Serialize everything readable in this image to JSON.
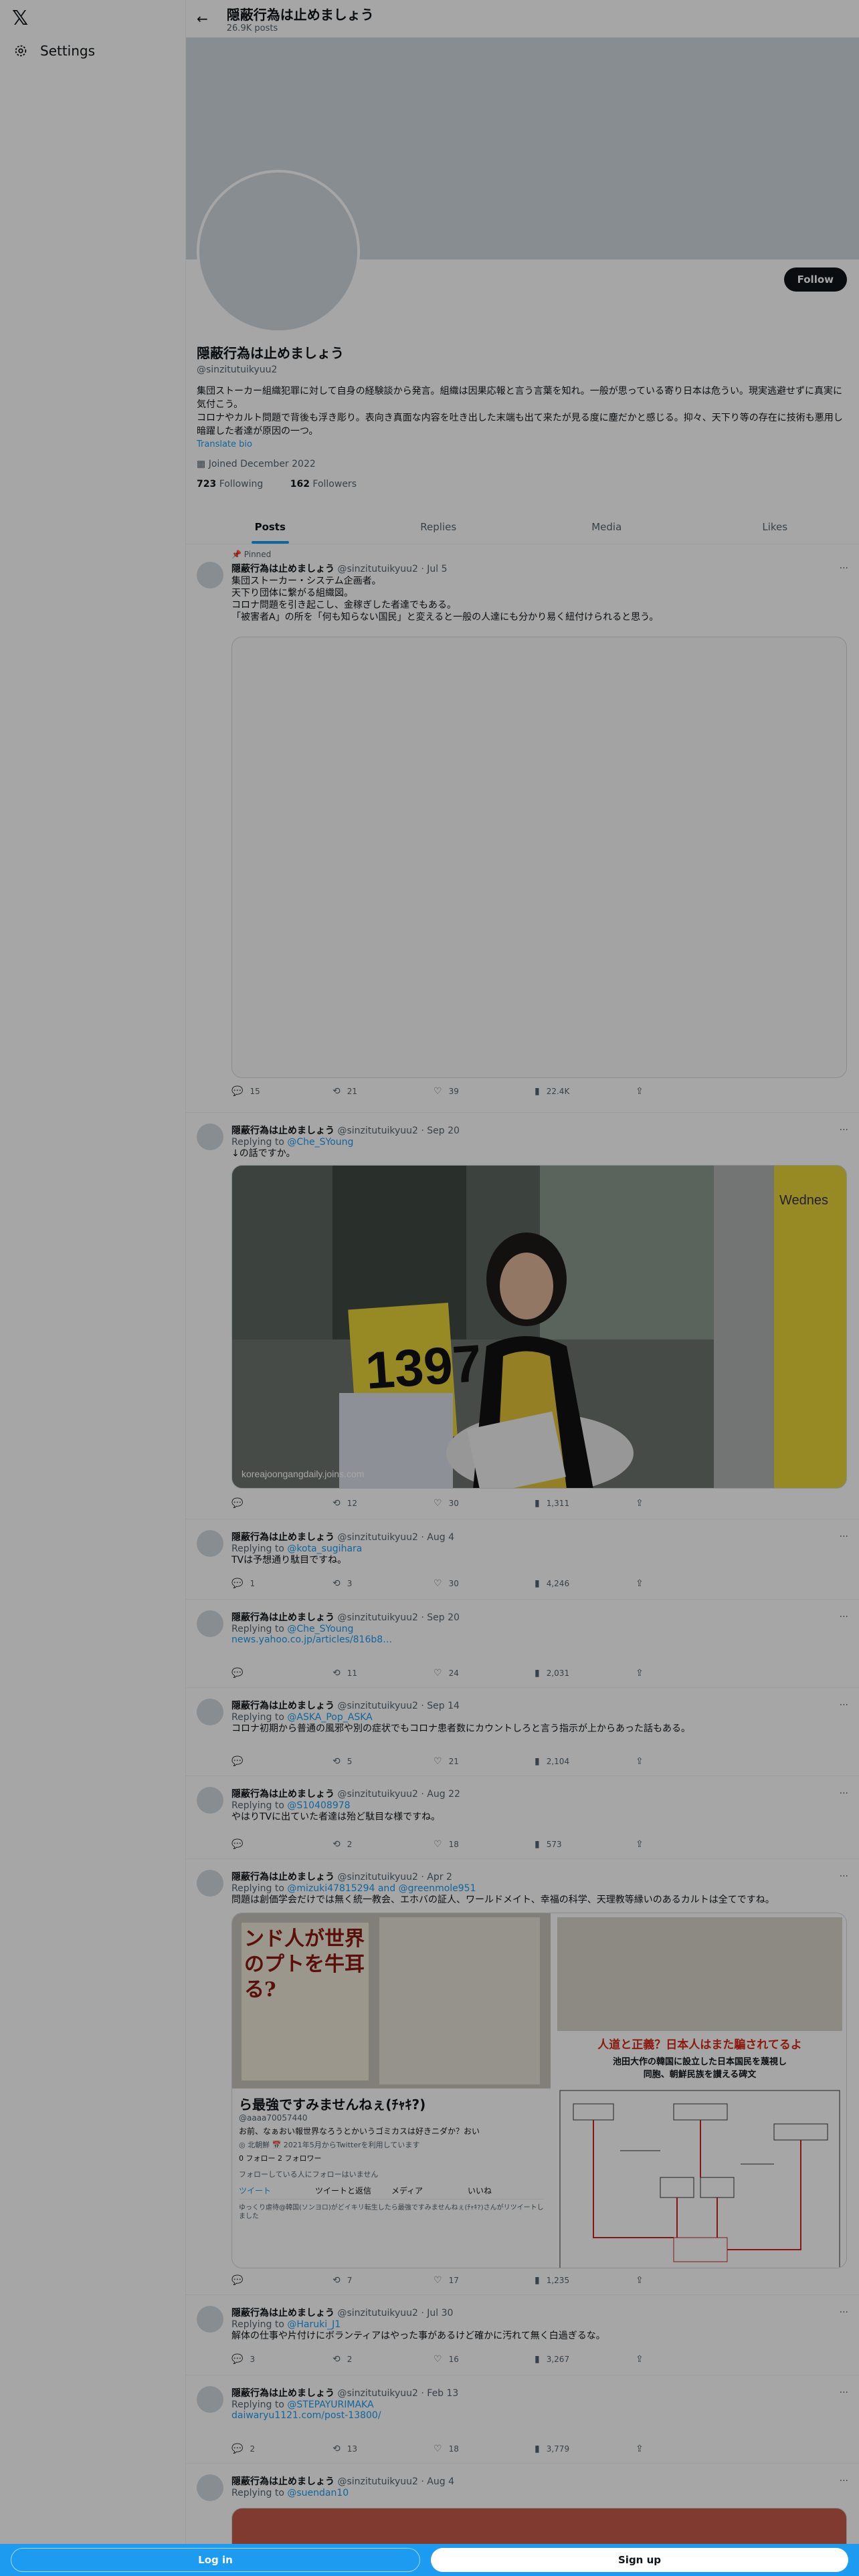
{
  "sidebar": {
    "logo": "𝕏",
    "settings_label": "Settings"
  },
  "topbar": {
    "name": "隠蔽行為は止めましょう",
    "posts": "26.9K posts"
  },
  "profile": {
    "follow_label": "Follow",
    "name": "隠蔽行為は止めましょう",
    "handle": "@sinzitutuikyuu2",
    "bio": "集団ストーカー組織犯罪に対して自身の経験談から発言。組織は因果応報と言う言葉を知れ。一般が思っている寄り日本は危うい。現実逃避せずに真実に気付こう。\nコロナやカルト問題で背後も浮き彫り。表向き真面な内容を吐き出した末端も出て来たが見る度に塵だかと感じる。抑々、天下り等の存在に技術も悪用し暗躍した者達が原因の一つ。",
    "translate": "Translate bio",
    "joined": "Joined December 2022",
    "following_count": "723",
    "following_label": "Following",
    "followers_count": "162",
    "followers_label": "Followers"
  },
  "tabs": [
    "Posts",
    "Replies",
    "Media",
    "Likes"
  ],
  "tweets": [
    {
      "pinned": "Pinned",
      "name": "隠蔽行為は止めましょう",
      "handle": "@sinzitutuikyuu2",
      "date": "· Jul 5",
      "reply_label": "",
      "reply_to": "",
      "text": "集団ストーカー・システム企画者。\n天下り団体に繋がる組織図。\nコロナ問題を引き起こし、金稼ぎした者達でもある。\n「被害者A」の所を「何も知らない国民」と変えると一般の人達にも分かり易く紐付けられると思う。",
      "link": "",
      "replies": "15",
      "retweets": "21",
      "likes": "39",
      "views": "22.4K"
    },
    {
      "pinned": "",
      "name": "隠蔽行為は止めましょう",
      "handle": "@sinzitutuikyuu2",
      "date": "· Sep 20",
      "reply_label": "Replying to",
      "reply_to": "@Che_SYoung",
      "text": "↓の話ですか。",
      "link": "",
      "replies": "",
      "retweets": "12",
      "likes": "30",
      "views": "1,311",
      "photo_sign": "1397",
      "photo_banner": "Wednes",
      "photo_caption": "koreajoongangdaily.joins.com"
    },
    {
      "pinned": "",
      "name": "隠蔽行為は止めましょう",
      "handle": "@sinzitutuikyuu2",
      "date": "· Aug 4",
      "reply_label": "Replying to",
      "reply_to": "@kota_sugihara",
      "text": "TVは予想通り駄目ですね。",
      "link": "",
      "replies": "1",
      "retweets": "3",
      "likes": "30",
      "views": "4,246"
    },
    {
      "pinned": "",
      "name": "隠蔽行為は止めましょう",
      "handle": "@sinzitutuikyuu2",
      "date": "· Sep 20",
      "reply_label": "Replying to",
      "reply_to": "@Che_SYoung",
      "text": "",
      "link": "news.yahoo.co.jp/articles/816b8…",
      "replies": "",
      "retweets": "11",
      "likes": "24",
      "views": "2,031"
    },
    {
      "pinned": "",
      "name": "隠蔽行為は止めましょう",
      "handle": "@sinzitutuikyuu2",
      "date": "· Sep 14",
      "reply_label": "Replying to",
      "reply_to": "@ASKA_Pop_ASKA",
      "text": "コロナ初期から普通の風邪や別の症状でもコロナ患者数にカウントしろと言う指示が上からあった話もある。",
      "link": "",
      "replies": "",
      "retweets": "5",
      "likes": "21",
      "views": "2,104"
    },
    {
      "pinned": "",
      "name": "隠蔽行為は止めましょう",
      "handle": "@sinzitutuikyuu2",
      "date": "· Aug 22",
      "reply_label": "Replying to",
      "reply_to": "@S10408978",
      "text": "やはりTVに出ていた者達は殆ど駄目な様ですね。",
      "link": "",
      "replies": "",
      "retweets": "2",
      "likes": "18",
      "views": "573"
    },
    {
      "pinned": "",
      "name": "隠蔽行為は止めましょう",
      "handle": "@sinzitutuikyuu2",
      "date": "· Apr 2",
      "reply_label": "Replying to",
      "reply_to": "@mizuki47815294 and @greenmole951",
      "text": "問題は創価学会だけでは無く統一教会、エホバの証人、ワールドメイト、幸福の科学、天理教等縁いのあるカルトは全てですね。",
      "link": "",
      "replies": "",
      "retweets": "7",
      "likes": "17",
      "views": "1,235",
      "img_left_headline": "ンド人が世界のプトを牛耳る?",
      "img_left_title": "ら最強ですみませんねぇ(ﾁｬｷ?)",
      "img_left_handle": "@aaaa70057440",
      "img_left_desc": "お前、なぁおい報世界なろうとかいうゴミカスは好きニダか？おい",
      "img_left_meta": "◎ 北朝鮮  📅 2021年5月からTwitterを利用しています",
      "img_left_follow": "0 フォロー  2 フォロワー",
      "img_left_nofollow": "フォローしている人にフォローはいません",
      "img_left_tabs": [
        "ツイート",
        "ツイートと返信",
        "メディア",
        "いいね"
      ],
      "img_left_rt": "ゆっくり虐待@韓国(ソンヨロ)がどイキリ転生したら最強ですみませんねぇ(ﾁｬｷ?)さんがリツイートしました",
      "img_right_headline": "人道と正義？日本人はまた騙されてるよ",
      "img_right_sub1": "池田大作の韓国に設立した日本国民を蔑視し",
      "img_right_sub2": "同胞、朝鮮民族を讃える碑文"
    },
    {
      "pinned": "",
      "name": "隠蔽行為は止めましょう",
      "handle": "@sinzitutuikyuu2",
      "date": "· Jul 30",
      "reply_label": "Replying to",
      "reply_to": "@Haruki_J1",
      "text": "解体の仕事や片付けにボランティアはやった事があるけど確かに汚れて無く白過ぎるな。",
      "link": "",
      "replies": "3",
      "retweets": "2",
      "likes": "16",
      "views": "3,267"
    },
    {
      "pinned": "",
      "name": "隠蔽行為は止めましょう",
      "handle": "@sinzitutuikyuu2",
      "date": "· Feb 13",
      "reply_label": "Replying to",
      "reply_to": "@STEPAYURIMAKA",
      "text": "",
      "link": "daiwaryu1121.com/post-13800/",
      "replies": "2",
      "retweets": "13",
      "likes": "18",
      "views": "3,779"
    },
    {
      "pinned": "",
      "name": "隠蔽行為は止めましょう",
      "handle": "@sinzitutuikyuu2",
      "date": "· Aug 4",
      "reply_label": "Replying to",
      "reply_to": "@suendan10",
      "text": "",
      "link": "",
      "replies": "",
      "retweets": "",
      "likes": "",
      "views": ""
    }
  ],
  "bottom": {
    "login": "Log in",
    "signup": "Sign up"
  },
  "colors": {
    "accent": "#1d9bf0",
    "text": "#0f1419",
    "muted": "#536471"
  }
}
